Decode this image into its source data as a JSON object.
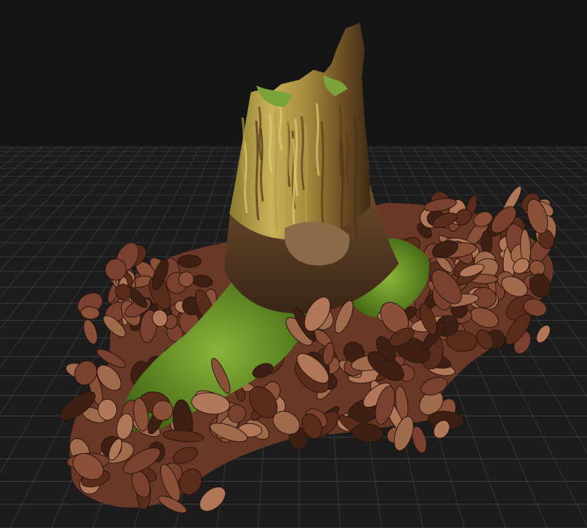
{
  "scene": {
    "subject": "tree-stump-3d-scan",
    "background_color": "#151515",
    "grid_floor_color": "#1c1c1c",
    "grid_line_color": "#4a4a4a",
    "colors": {
      "moss": "#5c8a1e",
      "moss_light": "#8ab53a",
      "wood_light": "#c9b25a",
      "wood_dark": "#5a3a1a",
      "bark": "#6b4a2b",
      "leaf": "#7a4030",
      "leaf_light": "#b07858",
      "leaf_dark": "#3e1f14"
    }
  }
}
